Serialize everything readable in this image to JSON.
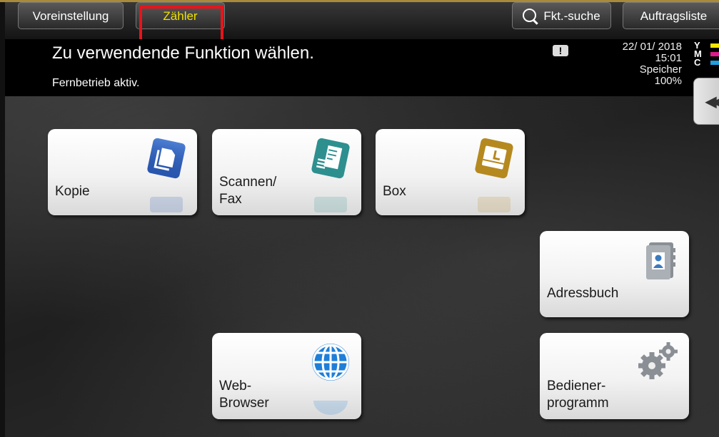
{
  "colors": {
    "counter_tab_text": "#f0e000",
    "highlight": "#e8141b",
    "toner_yellow": "#f5e600",
    "toner_magenta": "#e01a8c",
    "toner_cyan": "#1ea0e0"
  },
  "tabs": {
    "preset": "Voreinstellung",
    "counter": "Zähler",
    "search": "Fkt.-suche",
    "jobs": "Auftragsliste"
  },
  "message": {
    "title": "Zu verwendende Funktion wählen.",
    "subtitle": "Fernbetrieb aktiv.",
    "warning": "!"
  },
  "status": {
    "date": "22/ 01/ 2018",
    "time": "15:01",
    "memory_label": "Speicher",
    "memory_value": "100%",
    "toner": [
      "Y",
      "M",
      "C"
    ]
  },
  "side_handle": "◀◀",
  "tiles": {
    "copy": {
      "label": "Kopie",
      "icon": "copy-icon"
    },
    "scan": {
      "label_line1": "Scannen/",
      "label_line2": "Fax",
      "icon": "scan-fax-icon"
    },
    "box": {
      "label": "Box",
      "icon": "box-icon"
    },
    "address": {
      "label": "Adressbuch",
      "icon": "address-book-icon"
    },
    "web": {
      "label_line1": "Web-",
      "label_line2": "Browser",
      "icon": "globe-icon"
    },
    "utility": {
      "label_line1": "Bediener-",
      "label_line2": "programm",
      "icon": "gears-icon"
    }
  }
}
